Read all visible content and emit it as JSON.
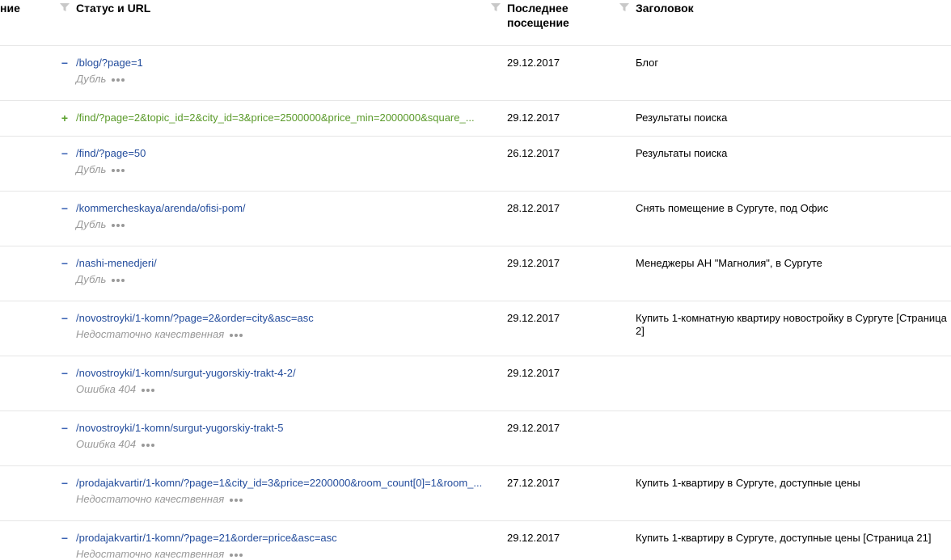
{
  "header": {
    "col0": "ние",
    "col1": "Статус и URL",
    "col2": "Последнее посещение",
    "col3": "Заголовок"
  },
  "rows": [
    {
      "toggle": "−",
      "url": "/blog/?page=1",
      "status": "Дубль",
      "date": "29.12.2017",
      "title": "Блог"
    },
    {
      "toggle": "+",
      "url": "/find/?page=2&topic_id=2&city_id=3&price=2500000&price_min=2000000&square_...",
      "status": "",
      "date": "29.12.2017",
      "title": "Результаты поиска"
    },
    {
      "toggle": "−",
      "url": "/find/?page=50",
      "status": "Дубль",
      "date": "26.12.2017",
      "title": "Результаты поиска"
    },
    {
      "toggle": "−",
      "url": "/kommercheskaya/arenda/ofisi-pom/",
      "status": "Дубль",
      "date": "28.12.2017",
      "title": "Снять помещение в Сургуте, под Офис"
    },
    {
      "toggle": "−",
      "url": "/nashi-menedjeri/",
      "status": "Дубль",
      "date": "29.12.2017",
      "title": "Менеджеры АН \"Магнолия\", в Сургуте"
    },
    {
      "toggle": "−",
      "url": "/novostroyki/1-komn/?page=2&order=city&asc=asc",
      "status": "Недостаточно качественная",
      "date": "29.12.2017",
      "title": "Купить 1-комнатную квартиру новостройку в Сургуте [Страница 2]"
    },
    {
      "toggle": "−",
      "url": "/novostroyki/1-komn/surgut-yugorskiy-trakt-4-2/",
      "status": "Ошибка 404",
      "date": "29.12.2017",
      "title": ""
    },
    {
      "toggle": "−",
      "url": "/novostroyki/1-komn/surgut-yugorskiy-trakt-5",
      "status": "Ошибка 404",
      "date": "29.12.2017",
      "title": ""
    },
    {
      "toggle": "−",
      "url": "/prodajakvartir/1-komn/?page=1&city_id=3&price=2200000&room_count[0]=1&room_...",
      "status": "Недостаточно качественная",
      "date": "27.12.2017",
      "title": "Купить 1-квартиру в Сургуте, доступные цены"
    },
    {
      "toggle": "−",
      "url": "/prodajakvartir/1-komn/?page=21&order=price&asc=asc",
      "status": "Недостаточно качественная",
      "date": "29.12.2017",
      "title": "Купить 1-квартиру в Сургуте, доступные цены [Страница 21]"
    }
  ],
  "icons": {
    "filter": "filter-icon",
    "more": "more-dots-icon"
  },
  "colors": {
    "link": "#234c9c",
    "new_link": "#5a9a2a",
    "status": "#999999",
    "divider": "#e6e6e6"
  }
}
